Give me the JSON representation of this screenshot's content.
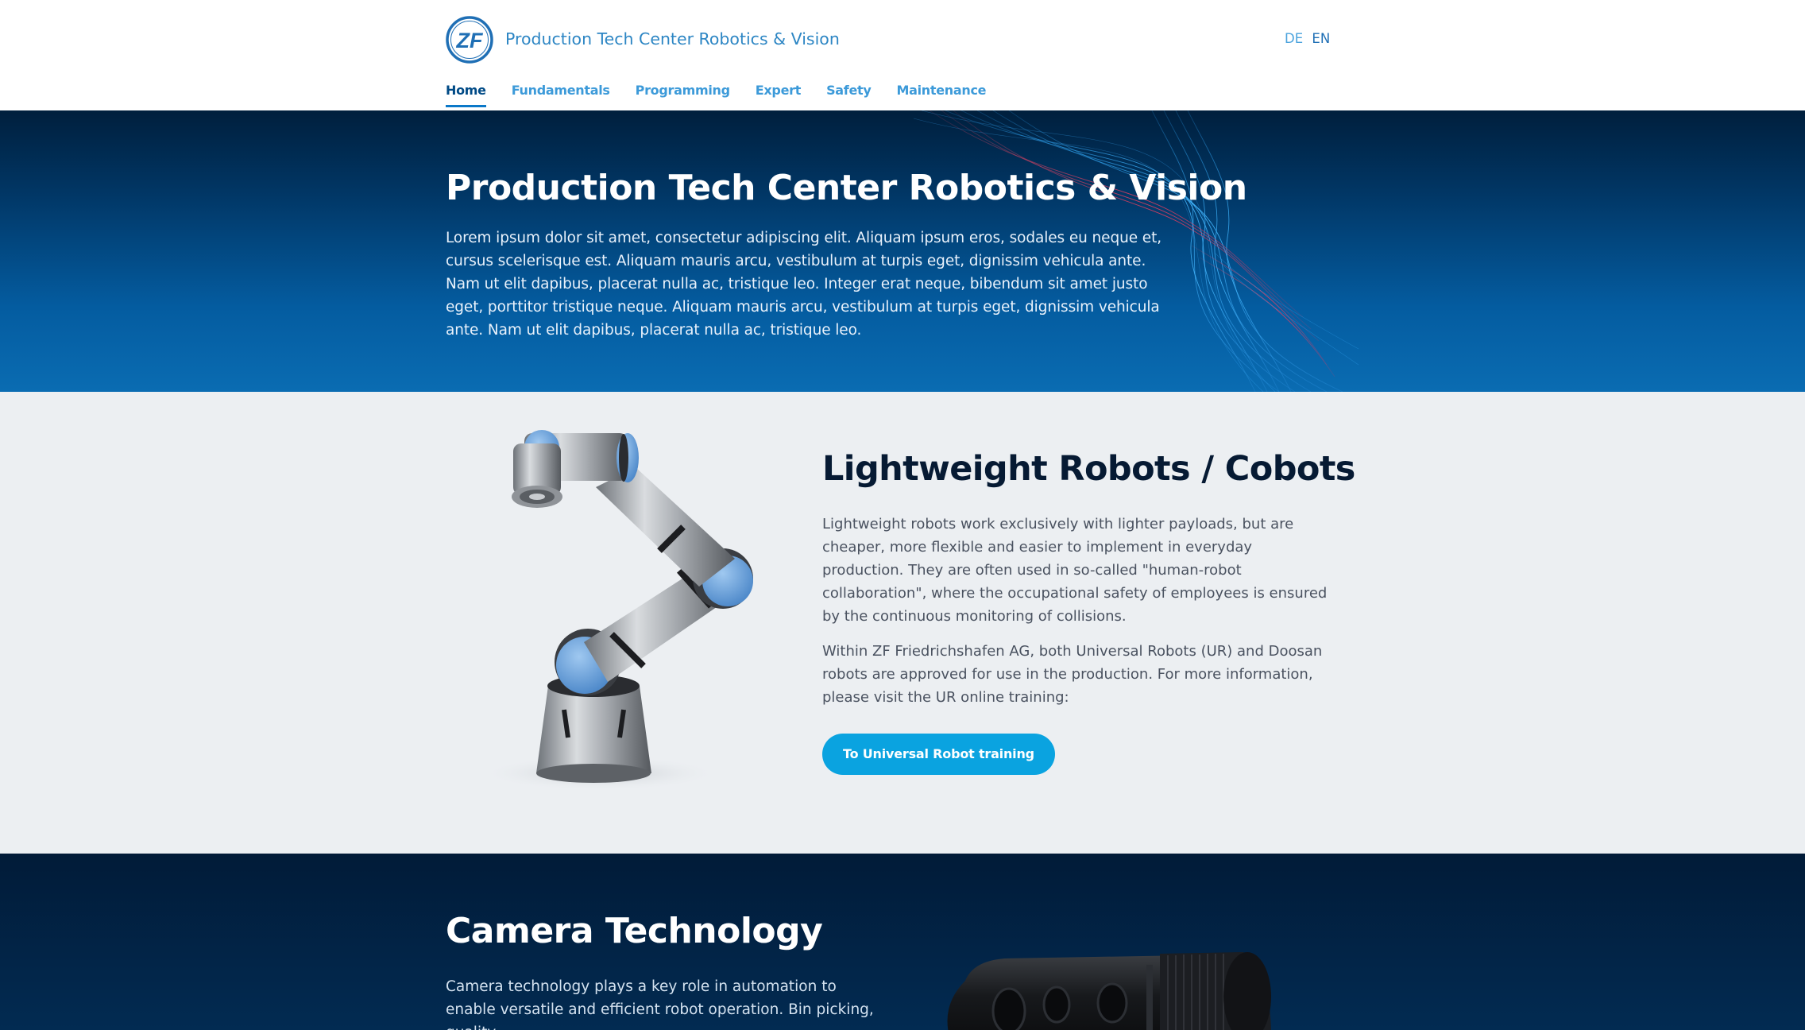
{
  "header": {
    "logo_text": "ZF",
    "site_title": "Production Tech Center Robotics & Vision",
    "lang": {
      "de": "DE",
      "en": "EN"
    }
  },
  "nav": {
    "items": [
      {
        "label": "Home",
        "active": true
      },
      {
        "label": "Fundamentals"
      },
      {
        "label": "Programming"
      },
      {
        "label": "Expert"
      },
      {
        "label": "Safety"
      },
      {
        "label": "Maintenance"
      }
    ]
  },
  "hero": {
    "title": "Production Tech Center Robotics & Vision",
    "text": "Lorem ipsum dolor sit amet, consectetur adipiscing elit. Aliquam ipsum eros, sodales eu neque et, cursus scelerisque est. Aliquam mauris arcu, vestibulum at turpis eget, dignissim vehicula ante. Nam ut elit dapibus, placerat nulla ac, tristique leo. Integer erat neque, bibendum sit amet justo eget, porttitor tristique neque. Aliquam mauris arcu, vestibulum at turpis eget, dignissim vehicula ante. Nam ut elit dapibus, placerat nulla ac, tristique leo."
  },
  "cobots": {
    "title": "Lightweight Robots / Cobots",
    "paragraph1": "Lightweight robots work exclusively with lighter payloads, but are cheaper, more flexible and easier to implement in everyday production. They are often used in so-called \"human-robot collaboration\", where the occupational safety of employees is ensured by the continuous monitoring of collisions.",
    "paragraph2": "Within ZF Friedrichshafen AG, both Universal Robots (UR) and Doosan robots are approved for use in the production. For more information, please visit the UR online training:",
    "button_label": "To Universal Robot training"
  },
  "camera": {
    "title": "Camera Technology",
    "text": "Camera technology plays a key role in automation to enable versatile and efficient robot operation. Bin picking, quality"
  },
  "colors": {
    "brand_blue": "#0b78c8",
    "nav_link": "#3c9ad9",
    "button": "#0aa3e0",
    "hero_dark": "#001f3d",
    "section_light": "#eceff2"
  }
}
